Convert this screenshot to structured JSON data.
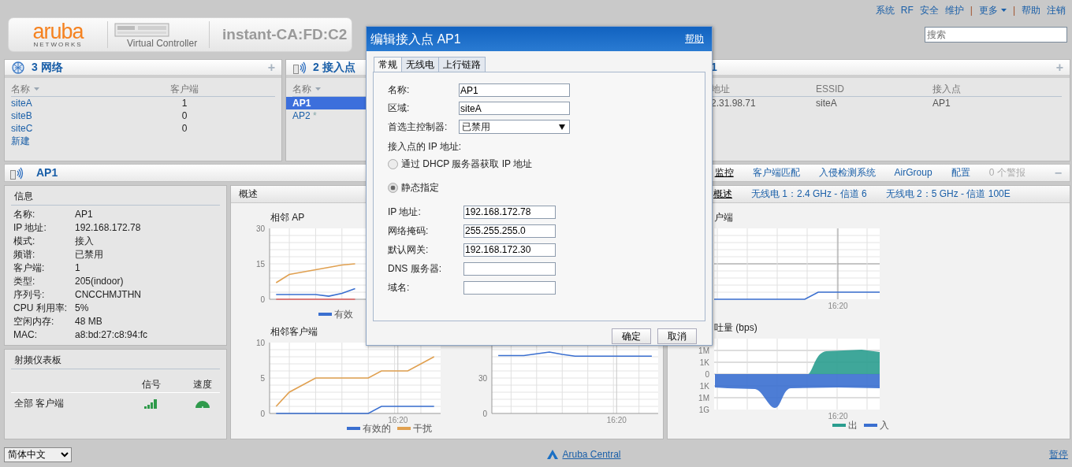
{
  "header": {
    "logo": "aruba",
    "logo_tagline": "NETWORKS",
    "product": "Virtual Controller",
    "controller_name": "instant-CA:FD:C2"
  },
  "top_nav": [
    {
      "kind": "link",
      "label": "系统"
    },
    {
      "kind": "link",
      "label": "RF"
    },
    {
      "kind": "link",
      "label": "安全"
    },
    {
      "kind": "link",
      "label": "维护"
    },
    {
      "kind": "separator",
      "label": "|"
    },
    {
      "kind": "dropdown",
      "label": "更多"
    },
    {
      "kind": "separator",
      "label": "|"
    },
    {
      "kind": "link",
      "label": "帮助"
    },
    {
      "kind": "link",
      "label": "注销"
    }
  ],
  "search": {
    "placeholder": "搜索"
  },
  "networks_panel": {
    "count": "3",
    "title": "网络",
    "add": "+",
    "columns": [
      {
        "label": "名称",
        "sortable": true
      },
      {
        "label": "客户端",
        "sortable": false
      }
    ],
    "rows": [
      {
        "name": "siteA",
        "clients": "1"
      },
      {
        "name": "siteB",
        "clients": "0"
      },
      {
        "name": "siteC",
        "clients": "0"
      }
    ],
    "new_link": "新建"
  },
  "access_points_panel": {
    "count": "2",
    "title": "接入点",
    "columns": [
      {
        "label": "名称",
        "sortable": true
      }
    ],
    "rows": [
      {
        "name": "AP1",
        "selected": true
      },
      {
        "name": "AP2",
        "flag": "*",
        "selected": false
      }
    ]
  },
  "clients_panel": {
    "title": "1",
    "add": "+",
    "columns": [
      "地址",
      "ESSID",
      "接入点"
    ],
    "rows": [
      {
        "address": "2.31.98.71",
        "essid": "siteA",
        "access_point": "AP1"
      }
    ]
  },
  "ap_bar": {
    "title": "AP1",
    "tabs": [
      {
        "label": "监控",
        "selected": true
      },
      {
        "label": "客户端匹配",
        "selected": false
      },
      {
        "label": "入侵检测系统",
        "selected": false
      },
      {
        "label": "AirGroup",
        "selected": false
      },
      {
        "label": "配置",
        "selected": false
      }
    ],
    "alerts": "0 个警报",
    "collapse": "−"
  },
  "info": {
    "title": "信息",
    "fields": [
      {
        "label": "名称:",
        "value": "AP1"
      },
      {
        "label": "IP 地址:",
        "value": "192.168.172.78"
      },
      {
        "label": "模式:",
        "value": "接入"
      },
      {
        "label": "频谱:",
        "value": "已禁用"
      },
      {
        "label": "客户端:",
        "value": "1"
      },
      {
        "label": "类型:",
        "value": "205(indoor)"
      },
      {
        "label": "序列号:",
        "value": "CNCCHMJTHN"
      },
      {
        "label": "CPU 利用率:",
        "value": "5%"
      },
      {
        "label": "空闲内存:",
        "value": "48 MB"
      },
      {
        "label": "MAC:",
        "value": "a8:bd:27:c8:94:fc"
      }
    ]
  },
  "rf_dashboard": {
    "title": "射频仪表板",
    "columns": [
      "信号",
      "速度"
    ],
    "rows": [
      {
        "name": "全部 客户端"
      }
    ]
  },
  "overview": {
    "title": "概述",
    "charts": [
      {
        "title": "相邻 AP",
        "chart_data": {
          "type": "line",
          "grid": true,
          "categories": [
            null,
            null,
            null,
            null,
            null,
            null,
            null,
            null,
            null,
            null,
            null,
            null,
            null
          ],
          "ylim": [
            0,
            30
          ],
          "yticks": [
            {
              "value": 0,
              "label": "0"
            },
            {
              "value": 15,
              "label": "15"
            },
            {
              "value": 30,
              "label": "30"
            }
          ],
          "series": [
            {
              "name": "有效",
              "color": "#3a6fd0",
              "values": [
                2,
                2,
                2,
                2,
                1.3,
                2.5,
                4.5,
                null,
                null,
                null,
                null,
                null,
                null
              ]
            },
            {
              "color": "#e0a050",
              "values": [
                7,
                10.5,
                11.5,
                12.5,
                13.5,
                14.5,
                15,
                null,
                null,
                null,
                null,
                null,
                null
              ]
            },
            {
              "color": "#e06060",
              "values": [
                0,
                0,
                0,
                0,
                0,
                0,
                0,
                null,
                null,
                null,
                null,
                null,
                null
              ]
            }
          ]
        }
      },
      {
        "title": "相邻客户端",
        "chart_data": {
          "type": "line",
          "grid": true,
          "categories": [
            null,
            null,
            null,
            null,
            null,
            null,
            null,
            null,
            null,
            null,
            null,
            null,
            null
          ],
          "ylim": [
            0,
            10
          ],
          "yticks": [
            {
              "value": 0,
              "label": "0"
            },
            {
              "value": 5,
              "label": "5"
            },
            {
              "value": 10,
              "label": "10"
            }
          ],
          "annotations": [
            {
              "text": "16:20"
            }
          ],
          "series": [
            {
              "name": "有效的",
              "color": "#3a6fd0",
              "values": [
                0,
                0,
                0,
                0,
                0,
                0,
                0,
                0,
                1,
                1,
                1,
                1,
                1
              ]
            },
            {
              "name": "干扰",
              "color": "#e0a050",
              "values": [
                1,
                3,
                4,
                5,
                5,
                5,
                5,
                5,
                6,
                6,
                6,
                7,
                8
              ]
            }
          ]
        }
      },
      {
        "chart_data": {
          "type": "line",
          "grid": true,
          "categories": [
            null,
            null,
            null,
            null,
            null,
            null,
            null,
            null,
            null,
            null,
            null,
            null,
            null
          ],
          "ylim": [
            0,
            60
          ],
          "yticks": [
            {
              "value": 0,
              "label": "0"
            },
            {
              "value": 30,
              "label": "30"
            }
          ],
          "annotations": [
            {
              "text": "16:20"
            }
          ],
          "series": [
            {
              "color": "#3a6fd0",
              "values": [
                49,
                49,
                49,
                50.5,
                52,
                50,
                48.5,
                48.5,
                48.5,
                48.5,
                48.5,
                48.5,
                48.5
              ]
            }
          ]
        }
      }
    ]
  },
  "radio_panel": {
    "tabs": [
      {
        "label": "概述",
        "selected": true
      },
      {
        "label": "无线电 1：2.4 GHz - 信道 6",
        "selected": false
      },
      {
        "label": "无线电 2：5 GHz - 信道 100E",
        "selected": false
      }
    ],
    "clients_chart": {
      "title": "户端",
      "x_label": "16:20"
    },
    "throughput_chart": {
      "title": "吐量 (bps)",
      "y_labels": [
        "1M",
        "1K",
        "0",
        "1K",
        "1M",
        "1G"
      ],
      "x_label": "16:20",
      "legend": [
        {
          "name": "出",
          "color": "#2a9d8f"
        },
        {
          "name": "入",
          "color": "#3a6fd0"
        }
      ]
    }
  },
  "footer": {
    "language": "简体中文",
    "central_link": "Aruba Central",
    "pause": "暂停"
  },
  "dialog": {
    "title": "编辑接入点 AP1",
    "help": "帮助",
    "tabs": [
      {
        "label": "常规",
        "selected": true
      },
      {
        "label": "无线电",
        "selected": false
      },
      {
        "label": "上行链路",
        "selected": false
      }
    ],
    "fields": [
      {
        "label": "名称:",
        "kind": "text",
        "value": "AP1"
      },
      {
        "label": "区域:",
        "kind": "text",
        "value": "siteA"
      },
      {
        "label": "首选主控制器:",
        "kind": "select",
        "value": "已禁用"
      }
    ],
    "ip_heading": "接入点的 IP 地址:",
    "ip_options": [
      {
        "label": "通过 DHCP 服务器获取 IP 地址",
        "selected": false
      },
      {
        "label": "静态指定",
        "selected": true
      }
    ],
    "ip_fields": [
      {
        "label": "IP 地址:",
        "value": "192.168.172.78"
      },
      {
        "label": "网络掩码:",
        "value": "255.255.255.0"
      },
      {
        "label": "默认网关:",
        "value": "192.168.172.30"
      },
      {
        "label": "DNS 服务器:"
      },
      {
        "label": "域名:"
      }
    ],
    "buttons": [
      "确定",
      "取消"
    ]
  }
}
